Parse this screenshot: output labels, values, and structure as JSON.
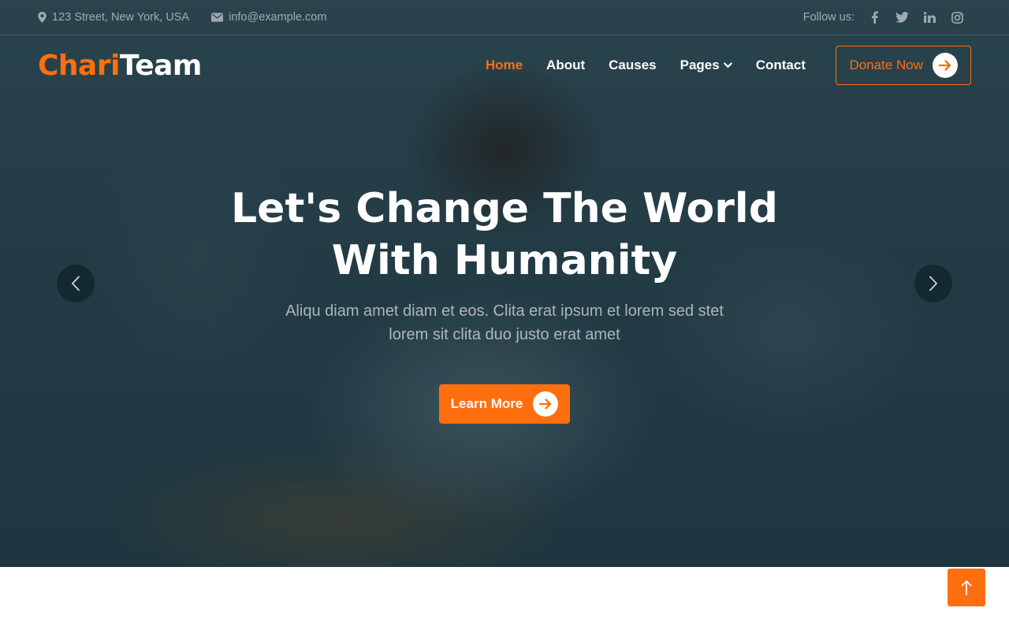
{
  "topbar": {
    "address": "123 Street, New York, USA",
    "email": "info@example.com",
    "follow_label": "Follow us:",
    "socials": [
      "facebook-icon",
      "twitter-icon",
      "linkedin-icon",
      "instagram-icon"
    ]
  },
  "brand": {
    "part1": "Chari",
    "part2": "Team"
  },
  "nav": {
    "items": [
      "Home",
      "About",
      "Causes",
      "Pages",
      "Contact"
    ],
    "active": "Home",
    "donate_label": "Donate Now"
  },
  "hero": {
    "title_line1": "Let's Change The World",
    "title_line2": "With Humanity",
    "subtitle_line1": "Aliqu diam amet diam et eos. Clita erat ipsum et lorem sed stet",
    "subtitle_line2": "lorem sit clita duo justo erat amet",
    "button_label": "Learn More"
  },
  "colors": {
    "accent": "#ff6f0f",
    "overlay": "#0c202a",
    "text_light": "#ffffff"
  }
}
